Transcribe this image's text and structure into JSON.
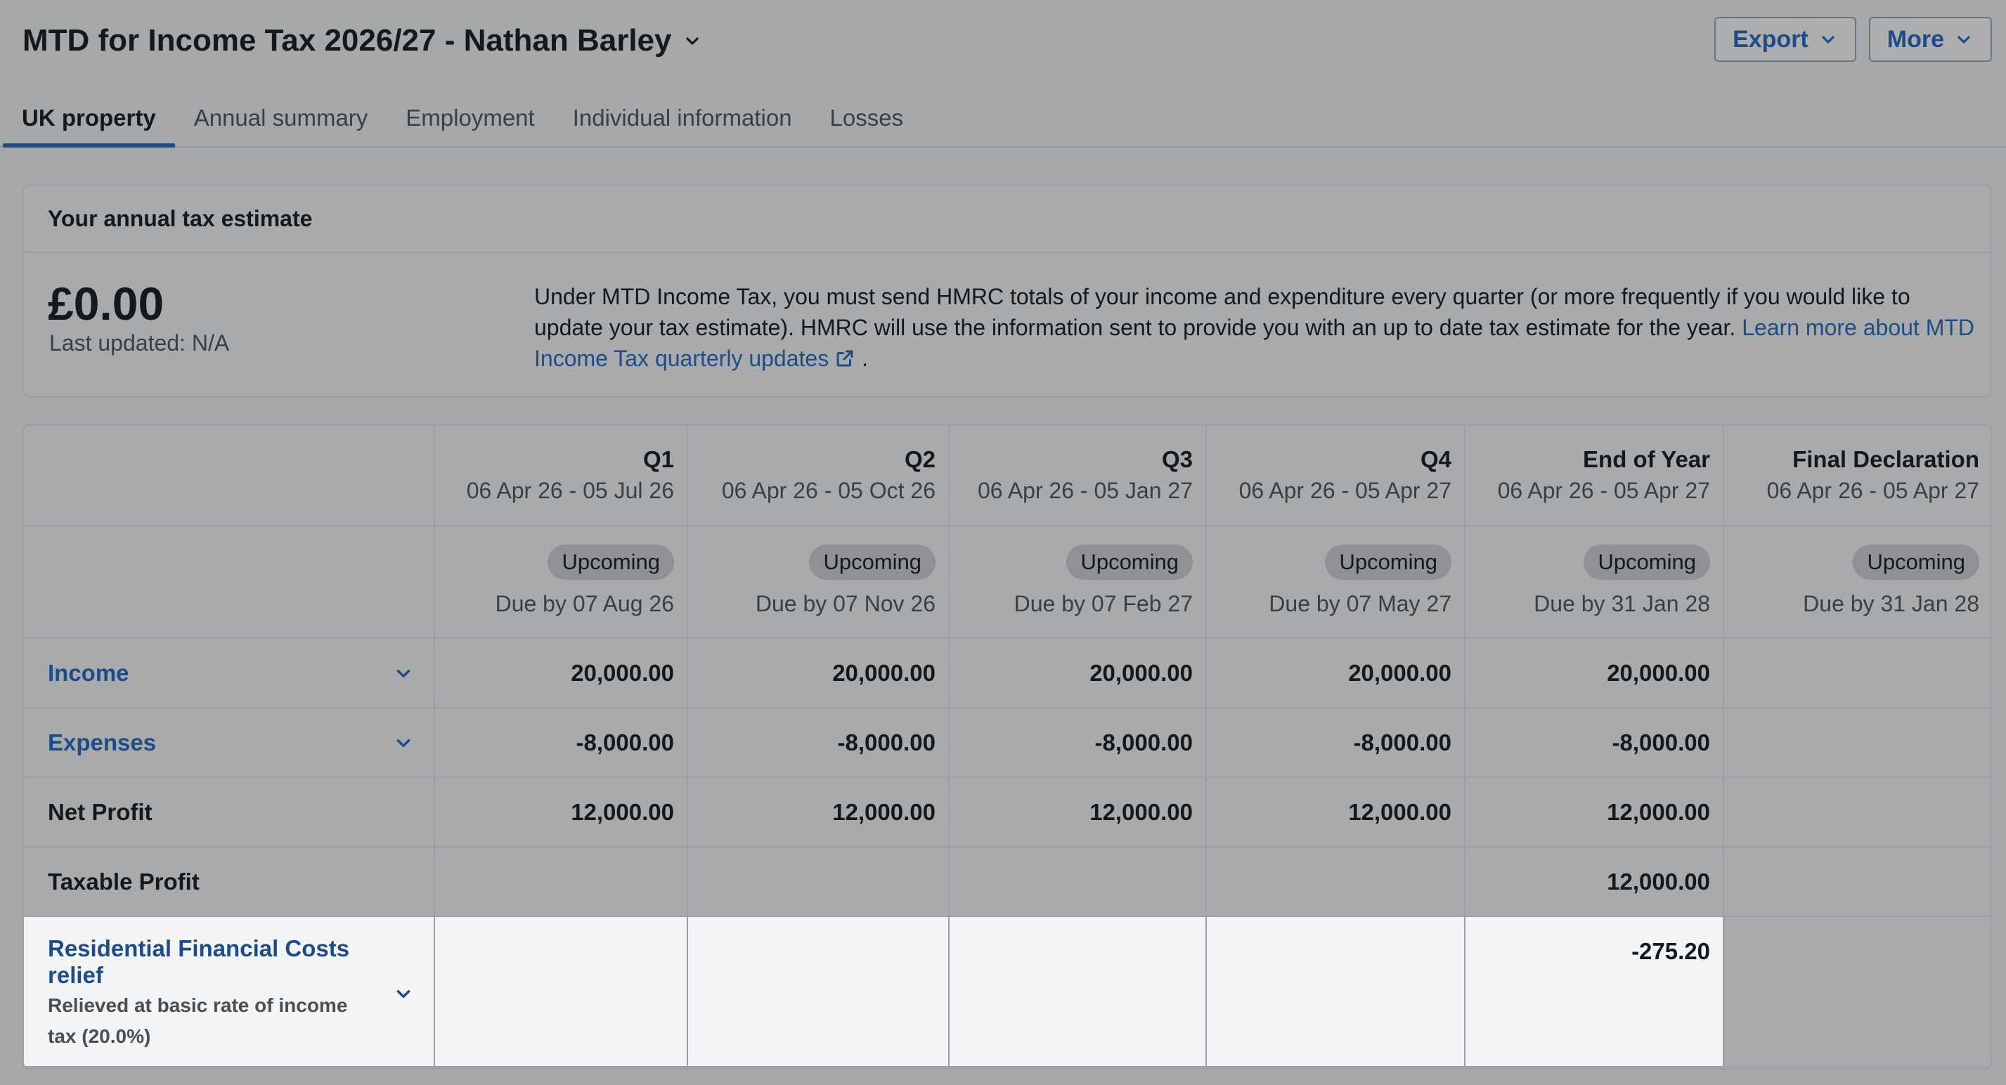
{
  "header": {
    "title": "MTD for Income Tax 2026/27 - Nathan Barley",
    "export_label": "Export",
    "more_label": "More"
  },
  "tabs": [
    {
      "label": "UK property",
      "active": true
    },
    {
      "label": "Annual summary"
    },
    {
      "label": "Employment"
    },
    {
      "label": "Individual information"
    },
    {
      "label": "Losses"
    }
  ],
  "estimate": {
    "heading": "Your annual tax estimate",
    "amount": "£0.00",
    "last_updated": "Last updated: N/A",
    "info_text": "Under MTD Income Tax, you must send HMRC totals of your income and expenditure every quarter (or more frequently if you would like to update your tax estimate). HMRC will use the information sent to provide you with an up to date tax estimate for the year. ",
    "info_link": "Learn more about MTD Income Tax quarterly updates",
    "info_end": "."
  },
  "periods": [
    {
      "name": "Q1",
      "range": "06 Apr 26 - 05 Jul 26",
      "status": "Upcoming",
      "due": "Due by 07 Aug 26"
    },
    {
      "name": "Q2",
      "range": "06 Apr 26 - 05 Oct 26",
      "status": "Upcoming",
      "due": "Due by 07 Nov 26"
    },
    {
      "name": "Q3",
      "range": "06 Apr 26 - 05 Jan 27",
      "status": "Upcoming",
      "due": "Due by 07 Feb 27"
    },
    {
      "name": "Q4",
      "range": "06 Apr 26 - 05 Apr 27",
      "status": "Upcoming",
      "due": "Due by 07 May 27"
    },
    {
      "name": "End of Year",
      "range": "06 Apr 26 - 05 Apr 27",
      "status": "Upcoming",
      "due": "Due by 31 Jan 28"
    },
    {
      "name": "Final Declaration",
      "range": "06 Apr 26 - 05 Apr 27",
      "status": "Upcoming",
      "due": "Due by 31 Jan 28"
    }
  ],
  "rows": {
    "income": {
      "label": "Income",
      "values": [
        "20,000.00",
        "20,000.00",
        "20,000.00",
        "20,000.00",
        "20,000.00",
        ""
      ]
    },
    "expenses": {
      "label": "Expenses",
      "values": [
        "-8,000.00",
        "-8,000.00",
        "-8,000.00",
        "-8,000.00",
        "-8,000.00",
        ""
      ]
    },
    "net_profit": {
      "label": "Net Profit",
      "values": [
        "12,000.00",
        "12,000.00",
        "12,000.00",
        "12,000.00",
        "12,000.00",
        ""
      ]
    },
    "taxable_profit": {
      "label": "Taxable Profit",
      "values": [
        "",
        "",
        "",
        "",
        "12,000.00",
        ""
      ]
    },
    "rfc": {
      "label": "Residential Financial Costs relief",
      "sublabel": "Relieved at basic rate of income tax (20.0%)",
      "values": [
        "",
        "",
        "",
        "",
        "-275.20",
        ""
      ]
    }
  },
  "colors": {
    "accent": "#1f4b87",
    "overlay_bg": "#a7a8a9",
    "highlight_row": "#f3f4f6"
  }
}
